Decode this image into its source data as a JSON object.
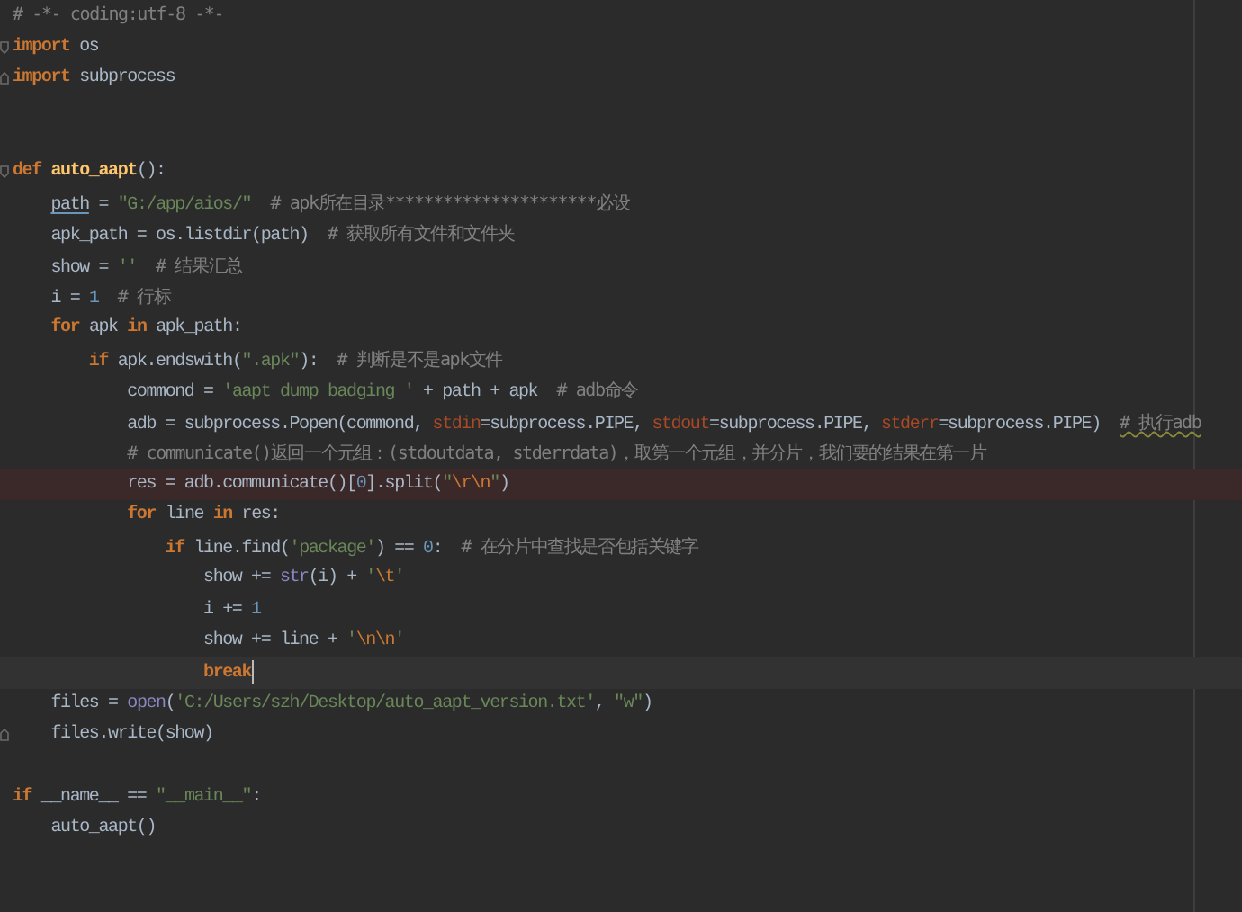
{
  "editor": {
    "lines": [
      {
        "marked": false,
        "current": false,
        "fold_start": false,
        "fold_end": false,
        "tokens": [
          {
            "text": "# -*- coding:utf-8 -*-",
            "kind": "comment"
          }
        ]
      },
      {
        "marked": false,
        "current": false,
        "fold_start": true,
        "fold_end": false,
        "tokens": [
          {
            "text": "import",
            "kind": "keyword"
          },
          {
            "text": " os",
            "kind": "plain"
          }
        ]
      },
      {
        "marked": false,
        "current": false,
        "fold_start": false,
        "fold_end": true,
        "tokens": [
          {
            "text": "import",
            "kind": "keyword"
          },
          {
            "text": " subprocess",
            "kind": "plain"
          }
        ]
      },
      {
        "marked": false,
        "current": false,
        "fold_start": false,
        "fold_end": false
      },
      {
        "marked": false,
        "current": false,
        "fold_start": false,
        "fold_end": false
      },
      {
        "marked": false,
        "current": false,
        "fold_start": true,
        "fold_end": false,
        "tokens": [
          {
            "text": "def",
            "kind": "keyword"
          },
          {
            "text": " auto_aapt",
            "kind": "funcname"
          },
          {
            "text": "():",
            "kind": "plain"
          }
        ]
      },
      {
        "marked": false,
        "current": false,
        "fold_start": false,
        "fold_end": false,
        "tokens": [
          {
            "text": "    path",
            "kind": "reference"
          },
          {
            "text": " = ",
            "kind": "plain"
          },
          {
            "text": "\"G:/app/aios/\"",
            "kind": "string"
          },
          {
            "text": "  # apk所在目录**********************必设",
            "kind": "comment"
          }
        ]
      },
      {
        "marked": false,
        "current": false,
        "fold_start": false,
        "fold_end": false,
        "tokens": [
          {
            "text": "    apk_path = os.listdir(path)",
            "kind": "plain"
          },
          {
            "text": "  # 获取所有文件和文件夹",
            "kind": "comment"
          }
        ]
      },
      {
        "marked": false,
        "current": false,
        "fold_start": false,
        "fold_end": false,
        "tokens": [
          {
            "text": "    show = ",
            "kind": "plain"
          },
          {
            "text": "''",
            "kind": "string"
          },
          {
            "text": "  # 结果汇总",
            "kind": "comment"
          }
        ]
      },
      {
        "marked": false,
        "current": false,
        "fold_start": false,
        "fold_end": false,
        "tokens": [
          {
            "text": "    i = ",
            "kind": "plain"
          },
          {
            "text": "1",
            "kind": "number"
          },
          {
            "text": "  # 行标",
            "kind": "comment"
          }
        ]
      },
      {
        "marked": false,
        "current": false,
        "fold_start": false,
        "fold_end": false,
        "tokens": [
          {
            "text": "    for",
            "kind": "keyword"
          },
          {
            "text": " apk ",
            "kind": "plain"
          },
          {
            "text": "in",
            "kind": "keyword"
          },
          {
            "text": " apk_path:",
            "kind": "plain"
          }
        ]
      },
      {
        "marked": false,
        "current": false,
        "fold_start": false,
        "fold_end": false,
        "tokens": [
          {
            "text": "        if",
            "kind": "keyword"
          },
          {
            "text": " apk.endswith(",
            "kind": "plain"
          },
          {
            "text": "\".apk\"",
            "kind": "string"
          },
          {
            "text": "):",
            "kind": "plain"
          },
          {
            "text": "  # 判断是不是apk文件",
            "kind": "comment"
          }
        ]
      },
      {
        "marked": false,
        "current": false,
        "fold_start": false,
        "fold_end": false,
        "tokens": [
          {
            "text": "            commond = ",
            "kind": "plain"
          },
          {
            "text": "'aapt dump badging '",
            "kind": "string"
          },
          {
            "text": " + path + apk",
            "kind": "plain"
          },
          {
            "text": "  # adb命令",
            "kind": "comment"
          }
        ]
      },
      {
        "marked": false,
        "current": false,
        "fold_start": false,
        "fold_end": false,
        "tokens": [
          {
            "text": "            adb = subprocess.Popen(commond, ",
            "kind": "plain"
          },
          {
            "text": "stdin",
            "kind": "param"
          },
          {
            "text": "=subprocess.PIPE, ",
            "kind": "plain"
          },
          {
            "text": "stdout",
            "kind": "param"
          },
          {
            "text": "=subprocess.PIPE, ",
            "kind": "plain"
          },
          {
            "text": "stderr",
            "kind": "param"
          },
          {
            "text": "=subprocess.PIPE)",
            "kind": "plain"
          },
          {
            "text": "  # 执行adb",
            "kind": "typo"
          }
        ]
      },
      {
        "marked": false,
        "current": false,
        "fold_start": false,
        "fold_end": false,
        "tokens": [
          {
            "text": "            # communicate()返回一个元组：(stdoutdata, stderrdata)，取第一个元组，并分片，我们要的结果在第一片",
            "kind": "comment"
          }
        ]
      },
      {
        "marked": true,
        "current": false,
        "fold_start": false,
        "fold_end": false,
        "tokens": [
          {
            "text": "            res = adb.communicate()[",
            "kind": "plain"
          },
          {
            "text": "0",
            "kind": "number"
          },
          {
            "text": "].split(",
            "kind": "plain"
          },
          {
            "text": "\"",
            "kind": "string"
          },
          {
            "text": "\\r\\n",
            "kind": "escape"
          },
          {
            "text": "\"",
            "kind": "string"
          },
          {
            "text": ")",
            "kind": "plain"
          }
        ]
      },
      {
        "marked": false,
        "current": false,
        "fold_start": false,
        "fold_end": false,
        "tokens": [
          {
            "text": "            for",
            "kind": "keyword"
          },
          {
            "text": " line ",
            "kind": "plain"
          },
          {
            "text": "in",
            "kind": "keyword"
          },
          {
            "text": " res:",
            "kind": "plain"
          }
        ]
      },
      {
        "marked": false,
        "current": false,
        "fold_start": false,
        "fold_end": false,
        "tokens": [
          {
            "text": "                if",
            "kind": "keyword"
          },
          {
            "text": " line.find(",
            "kind": "plain"
          },
          {
            "text": "'package'",
            "kind": "string"
          },
          {
            "text": ") == ",
            "kind": "plain"
          },
          {
            "text": "0",
            "kind": "number"
          },
          {
            "text": ":",
            "kind": "plain"
          },
          {
            "text": "  # 在分片中查找是否包括关键字",
            "kind": "comment"
          }
        ]
      },
      {
        "marked": false,
        "current": false,
        "fold_start": false,
        "fold_end": false,
        "tokens": [
          {
            "text": "                    show += ",
            "kind": "plain"
          },
          {
            "text": "str",
            "kind": "builtin"
          },
          {
            "text": "(i) + ",
            "kind": "plain"
          },
          {
            "text": "'",
            "kind": "string"
          },
          {
            "text": "\\t",
            "kind": "escape"
          },
          {
            "text": "'",
            "kind": "string"
          }
        ]
      },
      {
        "marked": false,
        "current": false,
        "fold_start": false,
        "fold_end": false,
        "tokens": [
          {
            "text": "                    i += ",
            "kind": "plain"
          },
          {
            "text": "1",
            "kind": "number"
          }
        ]
      },
      {
        "marked": false,
        "current": false,
        "fold_start": false,
        "fold_end": false,
        "tokens": [
          {
            "text": "                    show += line + ",
            "kind": "plain"
          },
          {
            "text": "'",
            "kind": "string"
          },
          {
            "text": "\\n\\n",
            "kind": "escape"
          },
          {
            "text": "'",
            "kind": "string"
          }
        ]
      },
      {
        "marked": false,
        "current": true,
        "fold_start": false,
        "fold_end": false,
        "tokens": [
          {
            "text": "                    break",
            "kind": "keyword"
          }
        ]
      },
      {
        "marked": false,
        "current": false,
        "fold_start": false,
        "fold_end": false,
        "tokens": [
          {
            "text": "    files = ",
            "kind": "plain"
          },
          {
            "text": "open",
            "kind": "builtin"
          },
          {
            "text": "(",
            "kind": "plain"
          },
          {
            "text": "'C:/Users/szh/Desktop/auto_aapt_version.txt'",
            "kind": "string"
          },
          {
            "text": ", ",
            "kind": "plain"
          },
          {
            "text": "\"w\"",
            "kind": "string"
          },
          {
            "text": ")",
            "kind": "plain"
          }
        ]
      },
      {
        "marked": false,
        "current": false,
        "fold_start": false,
        "fold_end": true,
        "tokens": [
          {
            "text": "    files.write(show)",
            "kind": "plain"
          }
        ]
      },
      {
        "marked": false,
        "current": false,
        "fold_start": false,
        "fold_end": false
      },
      {
        "marked": false,
        "current": false,
        "fold_start": false,
        "fold_end": false,
        "tokens": [
          {
            "text": "if",
            "kind": "keyword"
          },
          {
            "text": " __name__ == ",
            "kind": "plain"
          },
          {
            "text": "\"__main__\"",
            "kind": "string"
          },
          {
            "text": ":",
            "kind": "plain"
          }
        ]
      },
      {
        "marked": false,
        "current": false,
        "fold_start": false,
        "fold_end": false,
        "tokens": [
          {
            "text": "    auto_aapt()",
            "kind": "plain"
          }
        ]
      }
    ]
  }
}
